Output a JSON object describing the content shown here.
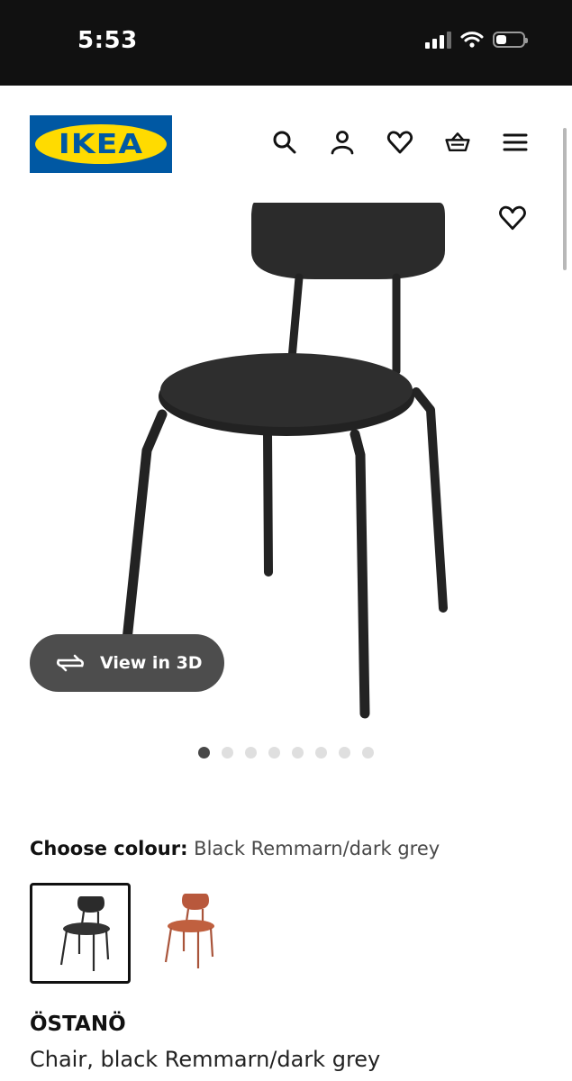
{
  "status_bar": {
    "time": "5:53"
  },
  "header": {
    "logo_text": "IKEA",
    "icons": [
      "search-icon",
      "user-icon",
      "heart-icon",
      "basket-icon",
      "menu-icon"
    ]
  },
  "gallery": {
    "view_3d_label": "View in 3D",
    "image_count": 8,
    "active_index": 0
  },
  "colour": {
    "label": "Choose colour:",
    "value": "Black Remmarn/dark grey",
    "options": [
      "black-dark-grey",
      "red-brown"
    ]
  },
  "product": {
    "name": "ÖSTANÖ",
    "description": "Chair, black Remmarn/dark grey"
  },
  "colors": {
    "ikea_blue": "#0058a3",
    "ikea_yellow": "#ffdb00",
    "chair_black": "#2b2b2b",
    "chair_red": "#b8583c"
  }
}
